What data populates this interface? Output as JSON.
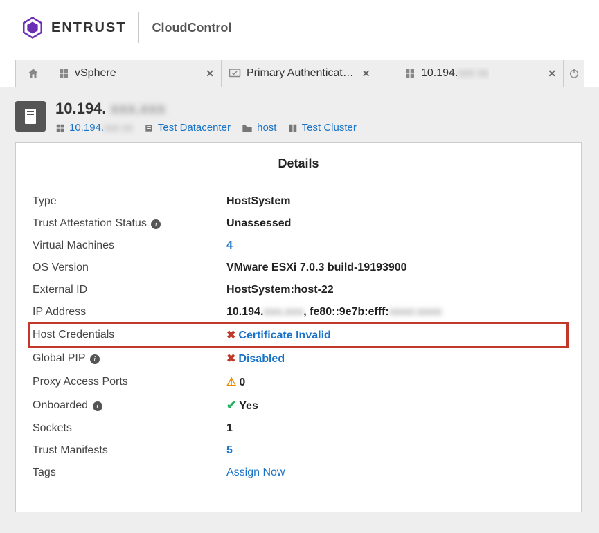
{
  "header": {
    "brand": "ENTRUST",
    "product": "CloudControl"
  },
  "tabs": [
    {
      "label": "vSphere",
      "icon": "vsphere-icon"
    },
    {
      "label": "Primary Authenticat…",
      "icon": "monitor-check-icon"
    },
    {
      "label": "10.194.",
      "redacted_suffix": "xxx xx",
      "icon": "vsphere-icon"
    }
  ],
  "page": {
    "title_prefix": "10.194.",
    "title_redacted": "xxx.xxx",
    "breadcrumbs": [
      {
        "label": "10.194.",
        "redacted_suffix": "xxx xx",
        "icon": "vsphere-icon"
      },
      {
        "label": "Test Datacenter",
        "icon": "datacenter-icon"
      },
      {
        "label": "host",
        "icon": "folder-icon"
      },
      {
        "label": "Test Cluster",
        "icon": "cluster-icon"
      }
    ]
  },
  "details": {
    "title": "Details",
    "rows": {
      "type": {
        "label": "Type",
        "value": "HostSystem"
      },
      "trust_status": {
        "label": "Trust Attestation Status",
        "value": "Unassessed",
        "info": true
      },
      "vms": {
        "label": "Virtual Machines",
        "value": "4",
        "link": true
      },
      "os": {
        "label": "OS Version",
        "value": "VMware ESXi 7.0.3 build-19193900"
      },
      "ext_id": {
        "label": "External ID",
        "value": "HostSystem:host-22"
      },
      "ip": {
        "label": "IP Address",
        "value_prefix": "10.194.",
        "value_mid": "xxx.xxx",
        "value_suffix": ", fe80::9e7b:efff:",
        "value_end": "xxxx:xxxx"
      },
      "host_creds": {
        "label": "Host Credentials",
        "value": "Certificate Invalid",
        "status": "x-red",
        "link": true,
        "highlight": true
      },
      "global_pip": {
        "label": "Global PIP",
        "value": "Disabled",
        "status": "x-red",
        "link": true,
        "info": true
      },
      "proxy_ports": {
        "label": "Proxy Access Ports",
        "value": "0",
        "status": "warn"
      },
      "onboarded": {
        "label": "Onboarded",
        "value": "Yes",
        "status": "ok",
        "info": true
      },
      "sockets": {
        "label": "Sockets",
        "value": "1"
      },
      "trust_manifests": {
        "label": "Trust Manifests",
        "value": "5",
        "link": true
      },
      "tags": {
        "label": "Tags",
        "value": "Assign Now",
        "link": true,
        "normalweight": true
      }
    }
  }
}
